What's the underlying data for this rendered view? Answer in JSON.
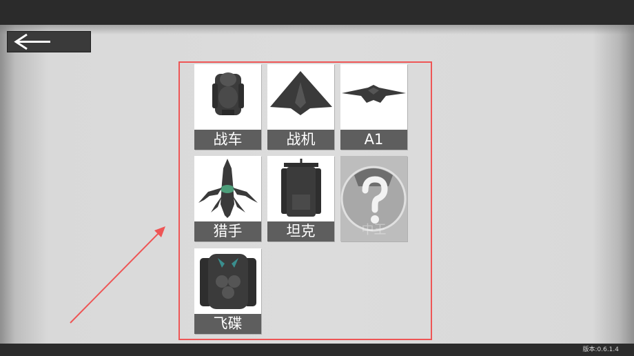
{
  "back_button": {
    "icon": "arrow-left-icon"
  },
  "units": [
    {
      "name": "战车",
      "icon": "combat-vehicle-icon",
      "locked": false
    },
    {
      "name": "战机",
      "icon": "fighter-jet-icon",
      "locked": false
    },
    {
      "name": "A1",
      "icon": "flying-wing-icon",
      "locked": false
    },
    {
      "name": "猎手",
      "icon": "hunter-creature-icon",
      "locked": false
    },
    {
      "name": "坦克",
      "icon": "tank-icon",
      "locked": false
    },
    {
      "name": "",
      "icon": "question-mark-icon",
      "locked": true,
      "faded_label": "中王"
    },
    {
      "name": "飞碟",
      "icon": "ufo-icon",
      "locked": false
    }
  ],
  "annotation": {
    "highlight_color": "#ee5555"
  },
  "footer": {
    "version": "版本:0.6.1.4"
  }
}
